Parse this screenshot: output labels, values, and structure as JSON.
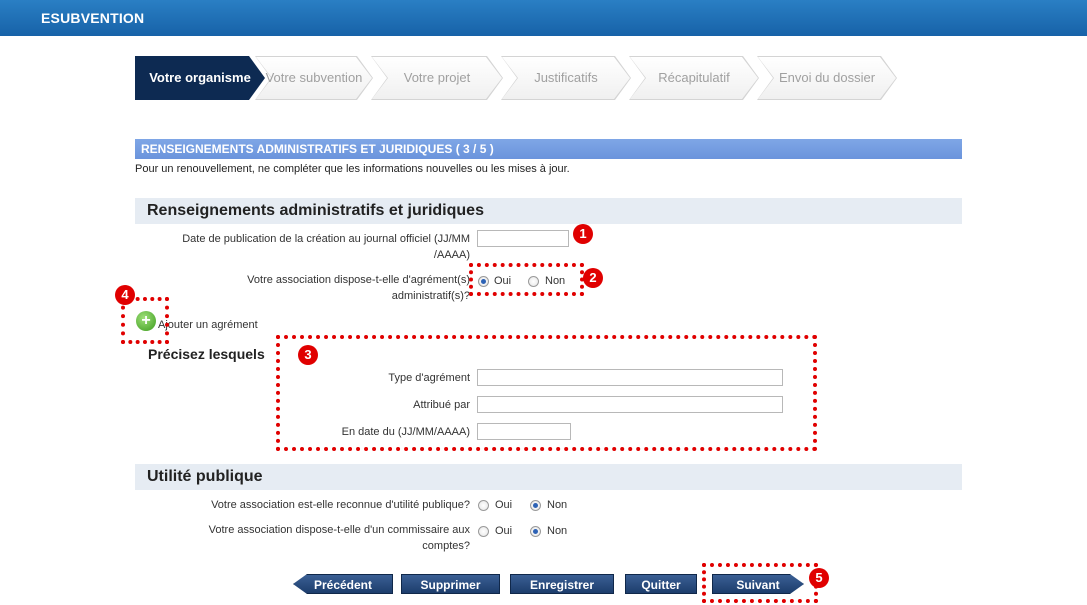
{
  "app": {
    "title": "ESUBVENTION"
  },
  "steps": [
    {
      "label": "Votre organisme",
      "active": true
    },
    {
      "label": "Votre subvention",
      "active": false
    },
    {
      "label": "Votre projet",
      "active": false
    },
    {
      "label": "Justificatifs",
      "active": false
    },
    {
      "label": "Récapitulatif",
      "active": false
    },
    {
      "label": "Envoi du dossier",
      "active": false
    }
  ],
  "section": {
    "title": "RENSEIGNEMENTS ADMINISTRATIFS ET JURIDIQUES ( 3 / 5 )",
    "intro": "Pour un renouvellement, ne compléter que les informations nouvelles ou les mises à jour."
  },
  "admin": {
    "heading": "Renseignements administratifs et juridiques",
    "date_label_line1": "Date de publication de la création au journal officiel (JJ/MM",
    "date_label_line2": "/AAAA)",
    "date_value": "",
    "agrement_label_line1": "Votre association dispose-t-elle d'agrément(s)",
    "agrement_label_line2": "administratif(s)?",
    "agrement_choice": "Oui",
    "oui": "Oui",
    "non": "Non",
    "add_label": "Ajouter un agrément",
    "precisez": "Précisez lesquels",
    "type_label": "Type d'agrément",
    "type_value": "",
    "attribue_label": "Attribué par",
    "attribue_value": "",
    "date_du_label": "En date du (JJ/MM/AAAA)",
    "date_du_value": ""
  },
  "utilite": {
    "heading": "Utilité publique",
    "q1": "Votre association est-elle reconnue d'utilité publique?",
    "q1_choice": "Non",
    "q2_line1": "Votre association dispose-t-elle d'un commissaire aux",
    "q2_line2": "comptes?",
    "q2_choice": "Non",
    "oui": "Oui",
    "non": "Non"
  },
  "buttons": {
    "precedent": "Précédent",
    "supprimer": "Supprimer",
    "enregistrer": "Enregistrer",
    "quitter": "Quitter",
    "suivant": "Suivant"
  },
  "annotations": [
    "1",
    "2",
    "3",
    "4",
    "5"
  ],
  "colors": {
    "topbar": "#1762a8",
    "section": "#6b94dc",
    "callout": "#e00000",
    "active_step": "#0d2a52"
  }
}
